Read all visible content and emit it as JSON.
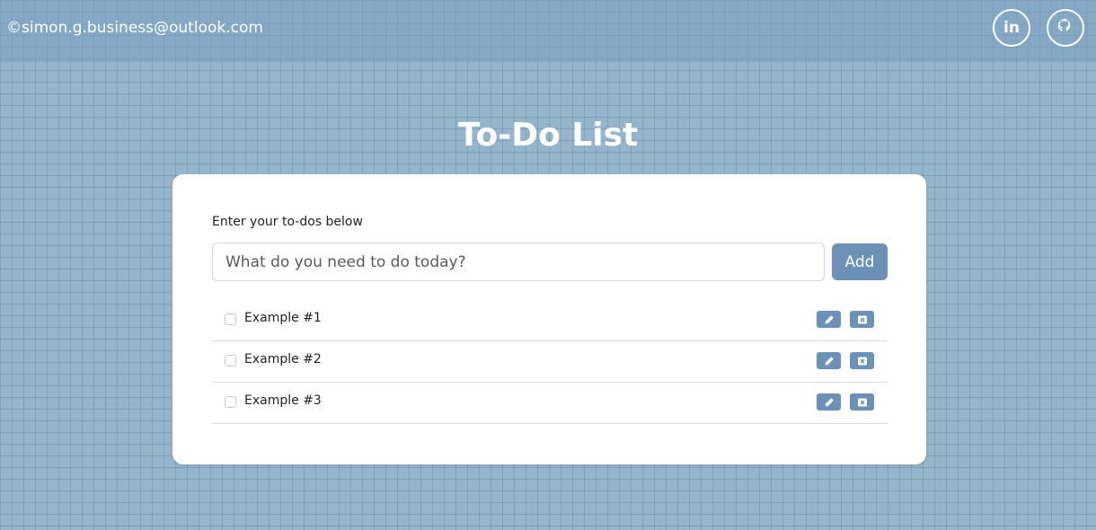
{
  "header": {
    "copyright": "©simon.g.business@outlook.com",
    "social": [
      {
        "name": "linkedin",
        "glyph": "in"
      },
      {
        "name": "github",
        "icon": "github-icon"
      }
    ]
  },
  "title": "To-Do List",
  "form": {
    "prompt": "Enter your to-dos below",
    "placeholder": "What do you need to do today?",
    "value": "",
    "add_label": "Add"
  },
  "todos": [
    {
      "label": "Example #1",
      "checked": false
    },
    {
      "label": "Example #2",
      "checked": false
    },
    {
      "label": "Example #3",
      "checked": false
    }
  ],
  "colors": {
    "accent": "#6b92b6",
    "background": "#95b5cc",
    "header": "#7fa3c2"
  }
}
